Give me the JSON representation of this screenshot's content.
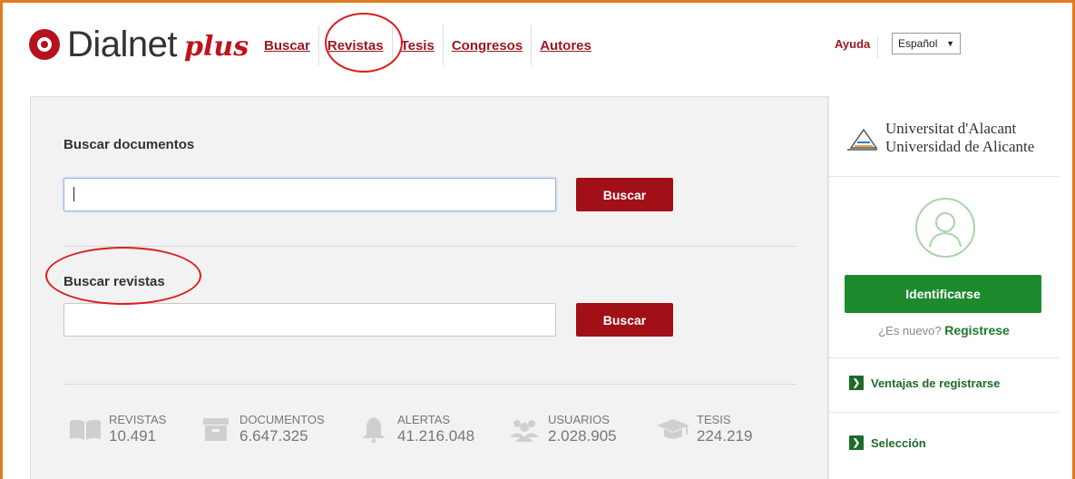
{
  "brand": {
    "name": "Dialnet",
    "suffix": "plus"
  },
  "nav": {
    "items": [
      {
        "label": "Buscar"
      },
      {
        "label": "Revistas"
      },
      {
        "label": "Tesis"
      },
      {
        "label": "Congresos"
      },
      {
        "label": "Autores"
      }
    ]
  },
  "header": {
    "help": "Ayuda",
    "language": "Español"
  },
  "search_docs": {
    "title": "Buscar documentos",
    "value": "",
    "button": "Buscar"
  },
  "search_journals": {
    "title": "Buscar revistas",
    "value": "",
    "button": "Buscar"
  },
  "stats": [
    {
      "label": "REVISTAS",
      "value": "10.491",
      "icon": "book-icon"
    },
    {
      "label": "DOCUMENTOS",
      "value": "6.647.325",
      "icon": "archive-box-icon"
    },
    {
      "label": "ALERTAS",
      "value": "41.216.048",
      "icon": "bell-icon"
    },
    {
      "label": "USUARIOS",
      "value": "2.028.905",
      "icon": "users-icon"
    },
    {
      "label": "TESIS",
      "value": "224.219",
      "icon": "graduation-cap-icon"
    }
  ],
  "sidebar": {
    "university": {
      "line1": "Universitat d'Alacant",
      "line2": "Universidad de Alicante"
    },
    "login_button": "Identificarse",
    "new_user_question": "¿Es nuevo?",
    "register_link": "Registrese",
    "links": [
      {
        "label": "Ventajas de registrarse"
      },
      {
        "label": "Selección"
      }
    ]
  },
  "colors": {
    "brand_red": "#a10f17",
    "accent_green": "#1e8a2e",
    "frame_orange": "#e07b22",
    "annotation_red": "#d91e1e"
  }
}
